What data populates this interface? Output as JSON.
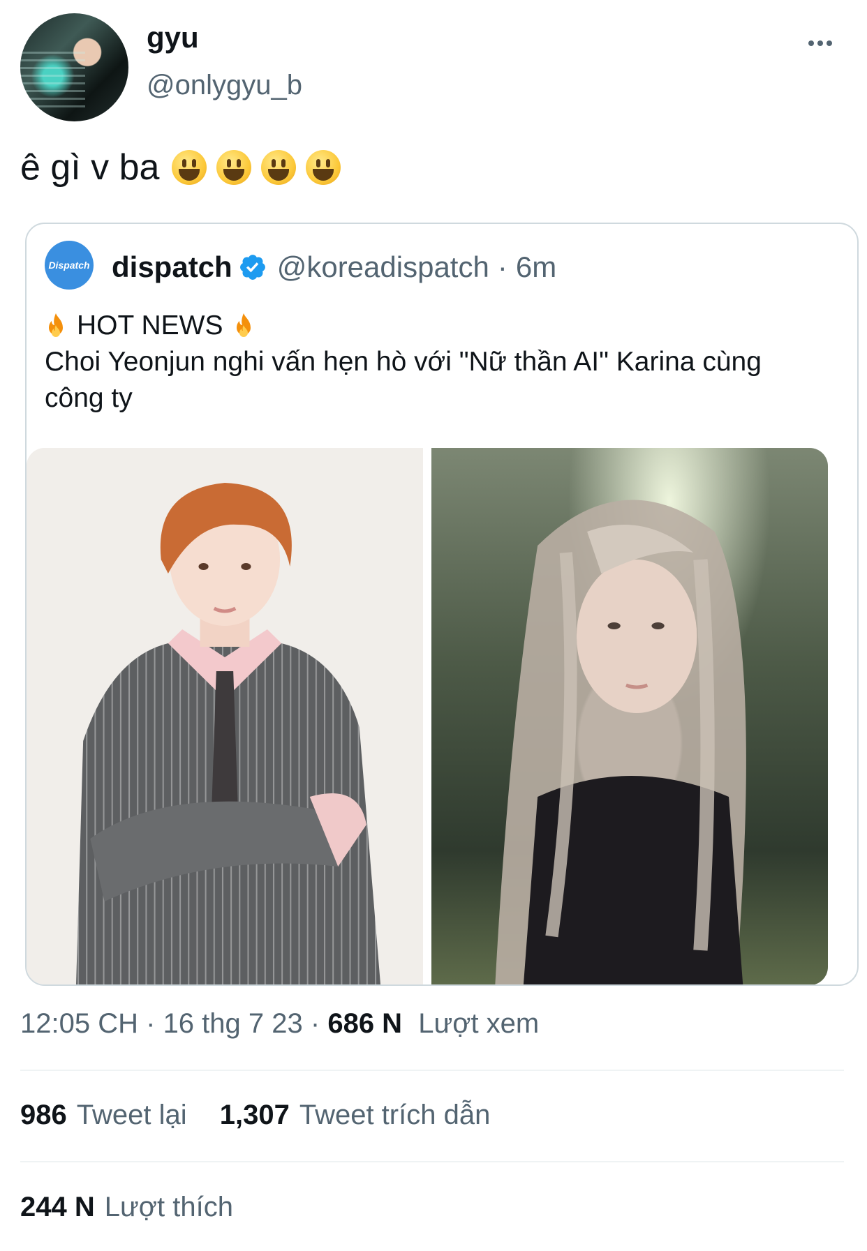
{
  "author": {
    "display_name": "gyu",
    "handle": "@onlygyu_b"
  },
  "tweet": {
    "text": "ê gì v ba",
    "emoji": [
      "grinning-face",
      "grinning-face",
      "grinning-face",
      "grinning-face"
    ]
  },
  "quoted": {
    "avatar_text": "Dispatch",
    "name": "dispatch",
    "handle": "@koreadispatch",
    "separator": "·",
    "time": "6m",
    "headline": "HOT NEWS",
    "body": "Choi Yeonjun nghi vấn hẹn hò với \"Nữ thần AI\" Karina cùng công ty",
    "verified_color": "#1d9bf0"
  },
  "meta": {
    "time": "12:05 CH",
    "sep1": "·",
    "date": "16 thg 7 23",
    "sep2": "·",
    "views_count": "686 N",
    "views_label": "Lượt xem"
  },
  "stats": {
    "retweets_count": "986",
    "retweets_label": "Tweet lại",
    "quotes_count": "1,307",
    "quotes_label": "Tweet trích dẫn",
    "likes_count": "244 N",
    "likes_label": "Lượt thích"
  }
}
